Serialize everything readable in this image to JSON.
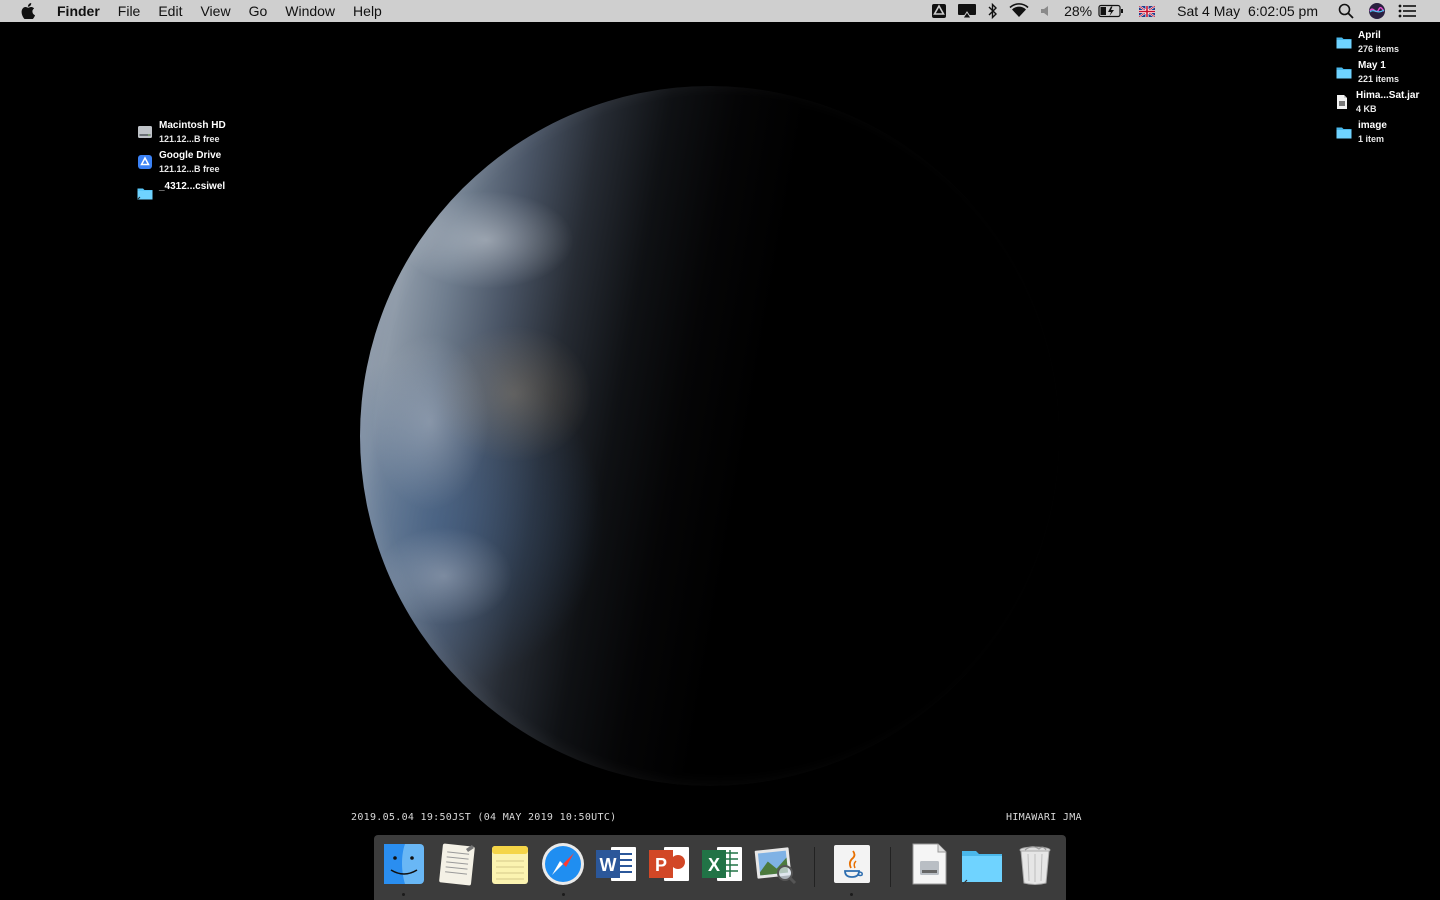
{
  "menubar": {
    "app_name": "Finder",
    "menus": [
      "File",
      "Edit",
      "View",
      "Go",
      "Window",
      "Help"
    ],
    "battery_percent": "28%",
    "datetime": "Sat 4 May  6:02:05 pm",
    "tray_icons": [
      "google-drive-icon",
      "airplay-icon",
      "bluetooth-icon",
      "wifi-icon",
      "volume-icon",
      "battery-icon",
      "uk-flag-icon",
      "spotlight-icon",
      "siri-icon",
      "notification-center-icon"
    ]
  },
  "desktop": {
    "left_items": [
      {
        "name": "Macintosh HD",
        "sub": "121.12...B free",
        "icon": "hard-drive-icon"
      },
      {
        "name": "Google Drive",
        "sub": "121.12...B free",
        "icon": "google-drive-volume-icon"
      },
      {
        "name": "_4312...csiwel",
        "sub": "",
        "icon": "folder-alias-icon"
      }
    ],
    "right_items": [
      {
        "name": "April",
        "sub": "276 items",
        "icon": "folder-icon"
      },
      {
        "name": "May 1",
        "sub": "221 items",
        "icon": "folder-icon"
      },
      {
        "name": "Hima...Sat.jar",
        "sub": "4 KB",
        "icon": "jar-file-icon"
      },
      {
        "name": "image",
        "sub": "1 item",
        "icon": "folder-icon"
      }
    ]
  },
  "wallpaper": {
    "caption_left": "2019.05.04 19:50JST (04 MAY 2019 10:50UTC)",
    "caption_right": "HIMAWARI JMA"
  },
  "dock": {
    "apps": [
      "finder",
      "textedit",
      "notes",
      "safari",
      "word",
      "powerpoint",
      "excel",
      "preview",
      "java",
      "disk-image",
      "downloads-folder",
      "trash"
    ],
    "running": [
      "finder",
      "safari",
      "java"
    ]
  },
  "colors": {
    "menubar_bg": "#cfcfcf",
    "folder_blue": "#5ac8fa",
    "word_blue": "#2b579a",
    "powerpoint_red": "#d24726",
    "excel_green": "#217346"
  }
}
